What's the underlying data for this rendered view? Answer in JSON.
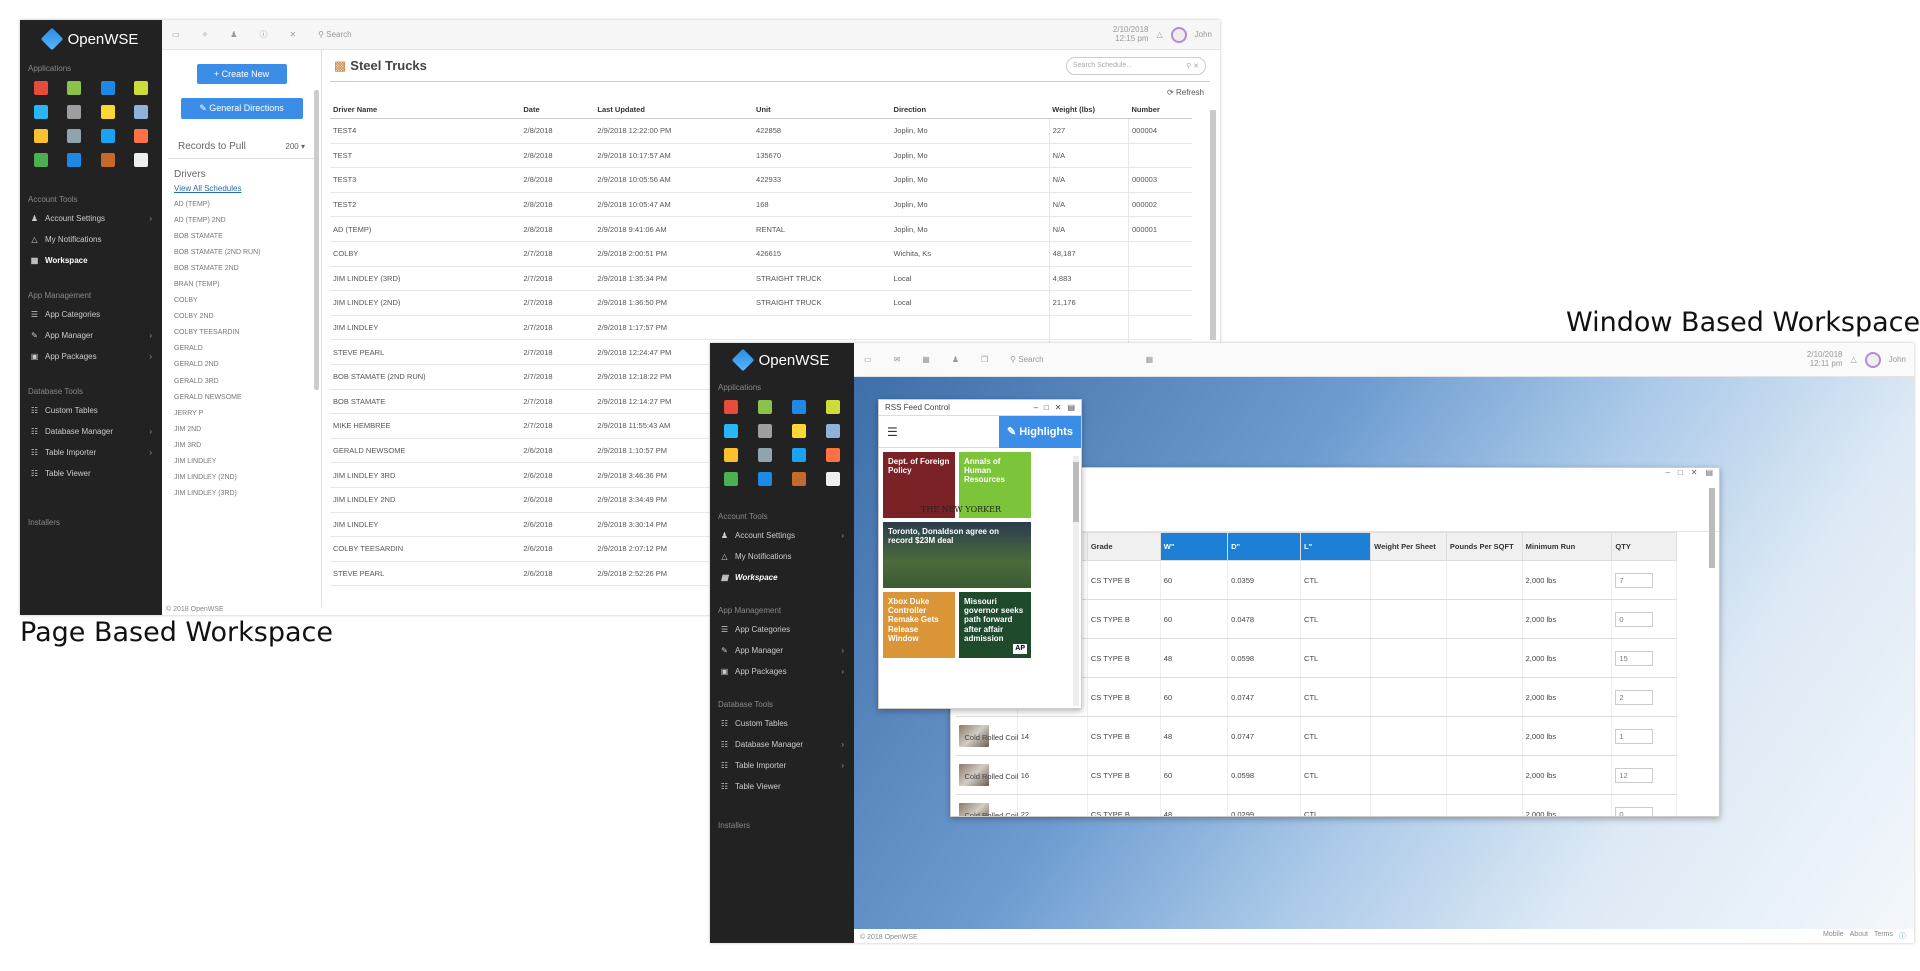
{
  "captions": {
    "page_based": "Page Based Workspace",
    "window_based": "Window Based Workspace"
  },
  "common": {
    "brand": "OpenWSE",
    "applications_label": "Applications",
    "account_tools": "Account Tools",
    "account_settings": "Account Settings",
    "my_notifications": "My Notifications",
    "workspace": "Workspace",
    "app_management": "App Management",
    "app_categories": "App Categories",
    "app_manager": "App Manager",
    "app_packages": "App Packages",
    "database_tools": "Database Tools",
    "custom_tables": "Custom Tables",
    "database_manager": "Database Manager",
    "table_importer": "Table Importer",
    "table_viewer": "Table Viewer",
    "installers": "Installers",
    "search": "Search",
    "user": "John",
    "footer": "© 2018 OpenWSE"
  },
  "page_shot": {
    "datetime": "2/10/2018\n12:15 pm",
    "create_new": "Create New",
    "general_directions": "General Directions",
    "records_label": "Records to Pull",
    "records_value": "200",
    "drivers_label": "Drivers",
    "view_all": "View All Schedules",
    "drivers": [
      "AD (TEMP)",
      "AD (TEMP) 2ND",
      "BOB STAMATE",
      "BOB STAMATE (2ND RUN)",
      "BOB STAMATE 2ND",
      "BRAN (TEMP)",
      "COLBY",
      "COLBY 2ND",
      "COLBY TEESARDIN",
      "GERALD",
      "GERALD 2ND",
      "GERALD 3RD",
      "GERALD NEWSOME",
      "JERRY P",
      "JIM 2ND",
      "JIM 3RD",
      "JIM LINDLEY",
      "JIM LINDLEY (2ND)",
      "JIM LINDLEY (3RD)"
    ],
    "title": "Steel Trucks",
    "search_placeholder": "Search Schedule...",
    "refresh": "Refresh",
    "headers": [
      "Driver Name",
      "Date",
      "Last Updated",
      "Unit",
      "Direction",
      "Weight (lbs)",
      "Number"
    ],
    "rows": [
      [
        "TEST4",
        "2/8/2018",
        "2/9/2018 12:22:00 PM",
        "422858",
        "Joplin, Mo",
        "227",
        "000004"
      ],
      [
        "TEST",
        "2/8/2018",
        "2/9/2018 10:17:57 AM",
        "135670",
        "Joplin, Mo",
        "N/A",
        ""
      ],
      [
        "TEST3",
        "2/8/2018",
        "2/9/2018 10:05:56 AM",
        "422933",
        "Joplin, Mo",
        "N/A",
        "000003"
      ],
      [
        "TEST2",
        "2/8/2018",
        "2/9/2018 10:05:47 AM",
        "168",
        "Joplin, Mo",
        "N/A",
        "000002"
      ],
      [
        "AD (TEMP)",
        "2/8/2018",
        "2/9/2018 9:41:06 AM",
        "RENTAL",
        "Joplin, Mo",
        "N/A",
        "000001"
      ],
      [
        "COLBY",
        "2/7/2018",
        "2/9/2018 2:00:51 PM",
        "426615",
        "Wichita, Ks",
        "48,187",
        ""
      ],
      [
        "JIM LINDLEY (3RD)",
        "2/7/2018",
        "2/9/2018 1:35:34 PM",
        "STRAIGHT TRUCK",
        "Local",
        "4,883",
        ""
      ],
      [
        "JIM LINDLEY (2ND)",
        "2/7/2018",
        "2/9/2018 1:36:50 PM",
        "STRAIGHT TRUCK",
        "Local",
        "21,176",
        ""
      ],
      [
        "JIM LINDLEY",
        "2/7/2018",
        "2/9/2018 1:17:57 PM",
        "",
        "",
        "",
        ""
      ],
      [
        "STEVE PEARL",
        "2/7/2018",
        "2/9/2018 12:24:47 PM",
        "",
        "",
        "",
        ""
      ],
      [
        "BOB STAMATE (2ND RUN)",
        "2/7/2018",
        "2/9/2018 12:18:22 PM",
        "",
        "",
        "",
        ""
      ],
      [
        "BOB STAMATE",
        "2/7/2018",
        "2/9/2018 12:14:27 PM",
        "",
        "",
        "",
        ""
      ],
      [
        "MIKE HEMBREE",
        "2/7/2018",
        "2/9/2018 11:55:43 AM",
        "",
        "",
        "",
        ""
      ],
      [
        "GERALD NEWSOME",
        "2/6/2018",
        "2/9/2018 1:10:57 PM",
        "",
        "",
        "",
        ""
      ],
      [
        "JIM LINDLEY 3RD",
        "2/6/2018",
        "2/9/2018 3:46:36 PM",
        "",
        "",
        "",
        ""
      ],
      [
        "JIM LINDLEY 2ND",
        "2/6/2018",
        "2/9/2018 3:34:49 PM",
        "",
        "",
        "",
        ""
      ],
      [
        "JIM LINDLEY",
        "2/6/2018",
        "2/9/2018 3:30:14 PM",
        "",
        "",
        "",
        ""
      ],
      [
        "COLBY TEESARDIN",
        "2/6/2018",
        "2/9/2018 2:07:12 PM",
        "",
        "",
        "",
        ""
      ],
      [
        "STEVE PEARL",
        "2/6/2018",
        "2/9/2018 2:52:26 PM",
        "",
        "",
        "",
        ""
      ]
    ]
  },
  "window_shot": {
    "datetime": "2/10/2018\n12:11 pm",
    "rss": {
      "title": "RSS Feed Control",
      "highlights": "Highlights",
      "tiles": [
        {
          "text": "Dept. of Foreign Policy",
          "bg": "#7a2226",
          "mast": ""
        },
        {
          "text": "Annals of Human Resources",
          "bg": "#7cc43a",
          "mast": "THE NEW YORKER"
        },
        {
          "text": "Toronto, Donaldson agree on record $23M deal",
          "bg": "#3d5a34",
          "mast": ""
        },
        {
          "text": "Xbox Duke Controller Remake Gets Release Window",
          "bg": "#d99537",
          "mast": ""
        },
        {
          "text": "Missouri governor seeks path forward after affair admission",
          "bg": "#1f4a2b",
          "mast": "AP"
        }
      ]
    },
    "products": {
      "headers": [
        "",
        "Gauge",
        "Grade",
        "W\"",
        "D\"",
        "L\"",
        "Weight Per Sheet",
        "Pounds Per SQFT",
        "Minimum Run",
        "QTY"
      ],
      "rows": [
        {
          "name": "",
          "gauge": "20",
          "grade": "CS TYPE B",
          "w": "60",
          "d": "0.0359",
          "l": "CTL",
          "wps": "",
          "pps": "",
          "min": "2,000 lbs",
          "qty": "7"
        },
        {
          "name": "",
          "gauge": "18",
          "grade": "CS TYPE B",
          "w": "60",
          "d": "0.0478",
          "l": "CTL",
          "wps": "",
          "pps": "",
          "min": "2,000 lbs",
          "qty": "0"
        },
        {
          "name": "",
          "gauge": "16",
          "grade": "CS TYPE B",
          "w": "48",
          "d": "0.0598",
          "l": "CTL",
          "wps": "",
          "pps": "",
          "min": "2,000 lbs",
          "qty": "15"
        },
        {
          "name": "",
          "gauge": "14",
          "grade": "CS TYPE B",
          "w": "60",
          "d": "0.0747",
          "l": "CTL",
          "wps": "",
          "pps": "",
          "min": "2,000 lbs",
          "qty": "2"
        },
        {
          "name": "Cold Rolled Coil",
          "gauge": "14",
          "grade": "CS TYPE B",
          "w": "48",
          "d": "0.0747",
          "l": "CTL",
          "wps": "",
          "pps": "",
          "min": "2,000 lbs",
          "qty": "1"
        },
        {
          "name": "Cold Rolled Coil",
          "gauge": "16",
          "grade": "CS TYPE B",
          "w": "60",
          "d": "0.0598",
          "l": "CTL",
          "wps": "",
          "pps": "",
          "min": "2,000 lbs",
          "qty": "12"
        },
        {
          "name": "Cold Rolled Coil",
          "gauge": "22",
          "grade": "CS TYPE B",
          "w": "48",
          "d": "0.0299",
          "l": "CTL",
          "wps": "",
          "pps": "",
          "min": "2,000 lbs",
          "qty": "0"
        }
      ]
    },
    "footer_links": [
      "Mobile",
      "About",
      "Terms"
    ]
  },
  "app_icon_colors": [
    "#e64b3c",
    "#8bc34a",
    "#1e88e5",
    "#cddc39",
    "#29b6f6",
    "#9e9e9e",
    "#fdd835",
    "#8db3d9",
    "#fbc02d",
    "#90a4ae",
    "#1da1f2",
    "#ff7043",
    "#4caf50",
    "#1e88e5",
    "#c56a2d",
    "#efefef"
  ]
}
